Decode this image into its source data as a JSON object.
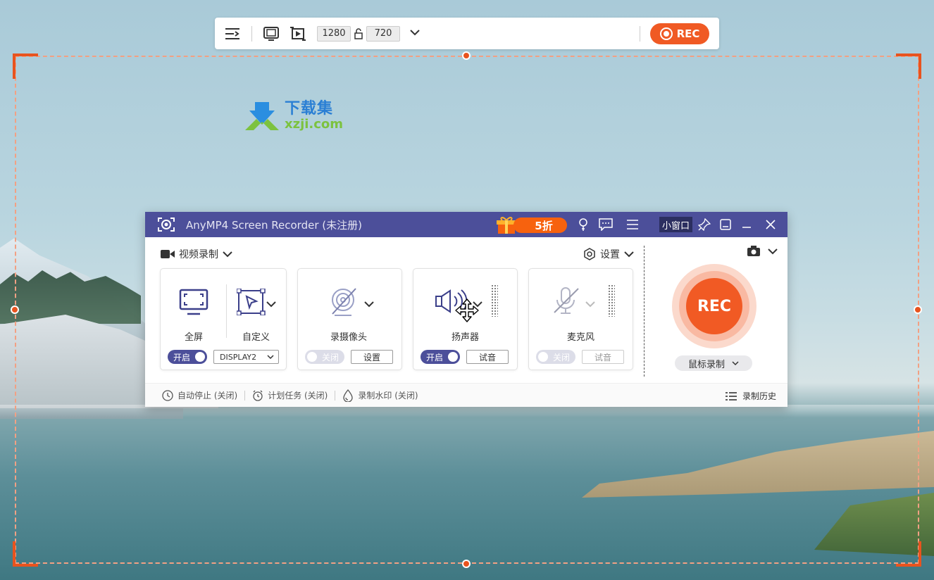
{
  "toolbar": {
    "width": "1280",
    "height": "720",
    "rec_label": "REC"
  },
  "watermark": {
    "cn": "下载集",
    "url": "xzji.com"
  },
  "window": {
    "title": "AnyMP4 Screen Recorder (未注册)",
    "promo": "5折",
    "mini_window": "小窗口"
  },
  "mode": {
    "label": "视频录制"
  },
  "settings": {
    "label": "设置"
  },
  "cards": {
    "screen": {
      "fullscreen": "全屏",
      "custom": "自定义",
      "toggle": "开启",
      "display": "DISPLAY2"
    },
    "webcam": {
      "label": "录摄像头",
      "toggle": "关闭",
      "button": "设置"
    },
    "speaker": {
      "label": "扬声器",
      "toggle": "开启",
      "button": "试音"
    },
    "mic": {
      "label": "麦克风",
      "toggle": "关闭",
      "button": "试音"
    }
  },
  "rec": {
    "label": "REC",
    "mouse_mode": "鼠标录制"
  },
  "footer": {
    "auto_stop": "自动停止 (关闭)",
    "schedule": "计划任务 (关闭)",
    "watermark": "录制水印 (关闭)",
    "history": "录制历史"
  },
  "colors": {
    "accent": "#f05a24",
    "titlebar": "#4c4f9a",
    "frame": "#e8531e"
  }
}
